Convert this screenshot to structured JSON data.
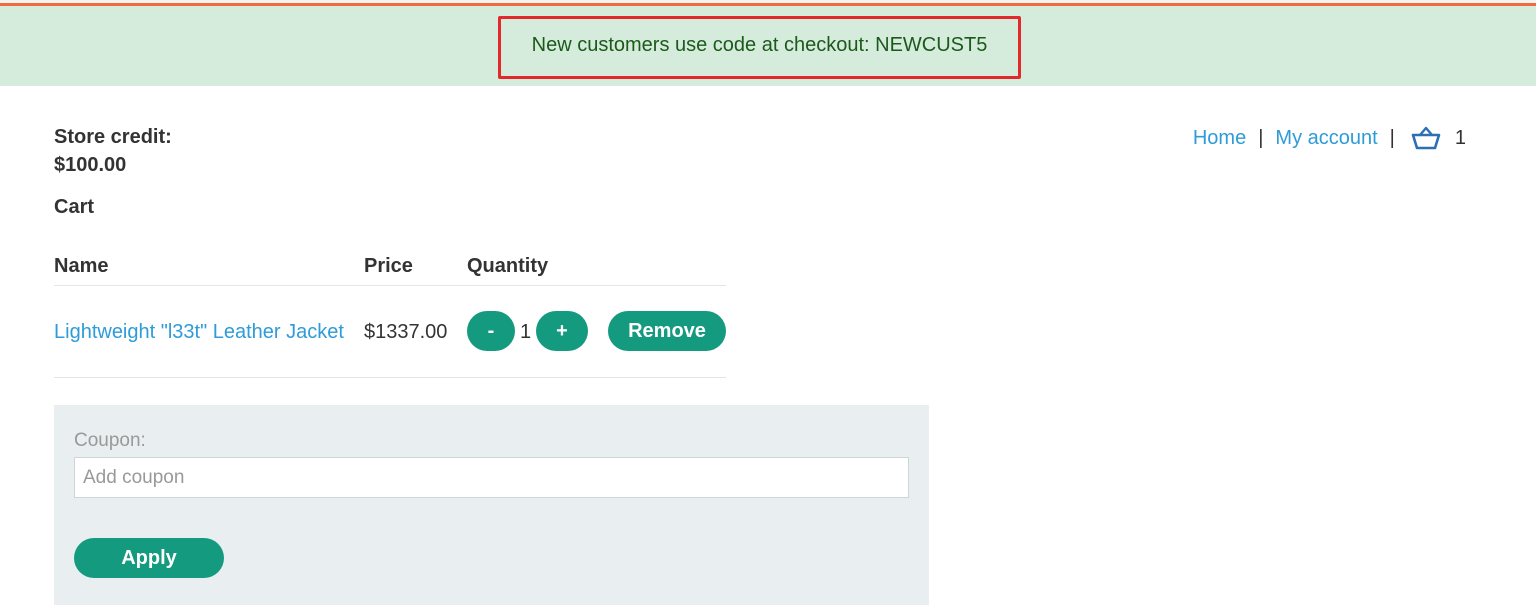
{
  "banner": {
    "text": "New customers use code at checkout: NEWCUST5"
  },
  "account": {
    "store_credit_label": "Store credit:",
    "store_credit_value": "$100.00"
  },
  "nav": {
    "home": "Home",
    "separator": "|",
    "my_account": "My account",
    "cart_icon": "basket-icon",
    "cart_count": "1"
  },
  "cart": {
    "title": "Cart",
    "columns": [
      "Name",
      "Price",
      "Quantity"
    ],
    "items": [
      {
        "name": "Lightweight \"l33t\" Leather Jacket",
        "price": "$1337.00",
        "quantity": "1",
        "minus_label": "-",
        "plus_label": "+",
        "remove_label": "Remove"
      }
    ]
  },
  "coupon": {
    "label": "Coupon:",
    "placeholder": "Add coupon",
    "value": "",
    "apply_label": "Apply"
  },
  "colors": {
    "accent_green": "#149a7f",
    "link_blue": "#2d9cd8",
    "banner_bg": "#d5ecdc",
    "highlight_red": "#e3292b",
    "top_accent": "#ef6a3c"
  }
}
